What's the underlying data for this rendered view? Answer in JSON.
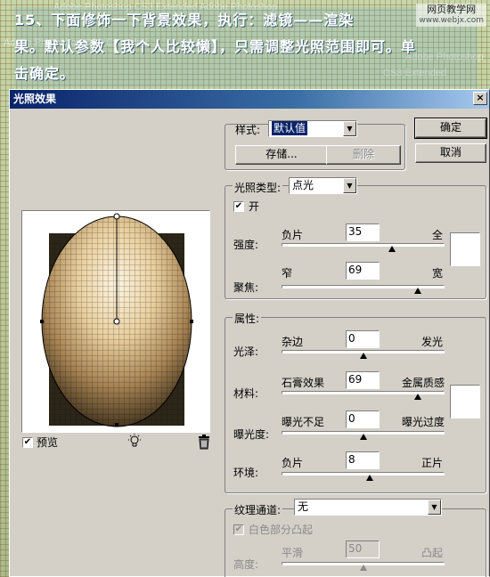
{
  "tutorial": {
    "line1": "15、下面修饰一下背景效果，执行：滤镜——渲染",
    "line2": "果。默认参数【我个人比较懒】，只需调整光照范围即可。单",
    "line3": "击确定。",
    "watermark_1": "Adobe Photoshop CS3 Extended  Adobe Photoshop",
    "watermark_2": "Adobe Photoshop",
    "watermark_3": "CS3 Extended",
    "watermark_4": "Adobe Photoshop CS3 Extended",
    "site_name": "网页教学网",
    "site_url": "www.webjx.com"
  },
  "dialog": {
    "title": "光照效果",
    "close": "×",
    "preview_label": "预览",
    "preview_checked": "✔",
    "style": {
      "label": "样式:",
      "value": "默认值",
      "save": "存储...",
      "delete": "删除"
    },
    "ok": "确定",
    "cancel": "取消",
    "light": {
      "type_label": "光照类型:",
      "type_value": "点光",
      "on_label": "开",
      "on_checked": "✔",
      "intensity": {
        "label": "强度:",
        "min": "负片",
        "max": "全",
        "value": "35",
        "fraction": 0.68
      },
      "focus": {
        "label": "聚焦:",
        "min": "窄",
        "max": "宽",
        "value": "69",
        "fraction": 0.84
      }
    },
    "properties": {
      "title": "属性:",
      "gloss": {
        "label": "光泽:",
        "min": "杂边",
        "max": "发光",
        "value": "0",
        "fraction": 0.5
      },
      "material": {
        "label": "材料:",
        "min": "石膏效果",
        "max": "金属质感",
        "value": "69",
        "fraction": 0.84
      },
      "exposure": {
        "label": "曝光度:",
        "min": "曝光不足",
        "max": "曝光过度",
        "value": "0",
        "fraction": 0.5
      },
      "ambience": {
        "label": "环境:",
        "min": "负片",
        "max": "正片",
        "value": "8",
        "fraction": 0.54
      }
    },
    "texture": {
      "label": "纹理通道:",
      "value": "无",
      "white_high_label": "白色部分凸起",
      "white_high_checked": "✔",
      "height": {
        "label": "高度:",
        "min": "平滑",
        "max": "凸起",
        "value": "50",
        "fraction": 0.5
      }
    },
    "colors": {
      "titlebar": "#0a246a",
      "face": "#d4d0c8"
    }
  }
}
